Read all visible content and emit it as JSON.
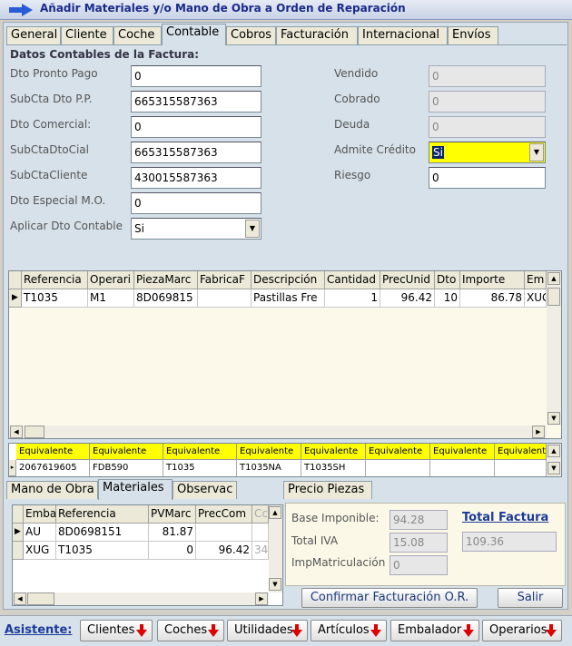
{
  "window": {
    "title": "Añadir Materiales y/o Mano de Obra a Orden de Reparación"
  },
  "tabs": [
    "General",
    "Cliente",
    "Coche",
    "Contable",
    "Cobros",
    "Facturación",
    "Internacional",
    "Envíos"
  ],
  "active_tab": "Contable",
  "section_title": "Datos Contables de la Factura:",
  "left_fields": [
    {
      "label": "Dto Pronto Pago",
      "value": "0"
    },
    {
      "label": "SubCta Dto P.P.",
      "value": "665315587363"
    },
    {
      "label": "Dto Comercial:",
      "value": "0"
    },
    {
      "label": "SubCtaDtoCial",
      "value": "665315587363"
    },
    {
      "label": "SubCtaCliente",
      "value": "430015587363"
    },
    {
      "label": "Dto Especial M.O.",
      "value": "0"
    },
    {
      "label": "Aplicar Dto Contable",
      "value": "Si"
    }
  ],
  "right_fields": [
    {
      "label": "Vendido",
      "value": "0"
    },
    {
      "label": "Cobrado",
      "value": "0"
    },
    {
      "label": "Deuda",
      "value": "0"
    },
    {
      "label": "Admite Crédito",
      "value": "Si"
    },
    {
      "label": "Riesgo",
      "value": "0"
    }
  ],
  "colors": {
    "highlight": "#ffff00",
    "panel": "#d6e1e9",
    "title_text": "#1a2a8a"
  },
  "main_grid": {
    "columns": [
      "Referencia",
      "Operari",
      "PiezaMarc",
      "FabricaF",
      "Descripción",
      "Cantidad",
      "PrecUnid",
      "Dto",
      "Importe",
      "Em"
    ],
    "rows": [
      [
        "T1035",
        "M1",
        "8D069815",
        "",
        "Pastillas Fre",
        "1",
        "96.42",
        "10",
        "86.78",
        "XUG"
      ]
    ]
  },
  "equiv_grid": {
    "headers": [
      "Equivalente",
      "Equivalente",
      "Equivalente",
      "Equivalente",
      "Equivalente",
      "Equivalente",
      "Equivalente",
      "Equivalent"
    ],
    "values": [
      "2067619605",
      "FDB590",
      "T1035",
      "T1035NA",
      "T1035SH",
      "",
      "",
      ""
    ]
  },
  "bottom_tabs": [
    "Mano de Obra",
    "Materiales",
    "Observac"
  ],
  "bottom_active_tab": "Materiales",
  "precio_tab": "Precio Piezas",
  "mat_grid": {
    "columns": [
      "Emba",
      "Referencia",
      "PVMarc",
      "PrecCom",
      "Cc"
    ],
    "rows": [
      [
        "AU",
        "8D0698151",
        "81.87",
        "",
        ""
      ],
      [
        "XUG",
        "T1035",
        "0",
        "96.42",
        "34"
      ]
    ]
  },
  "totals": {
    "base_label": "Base Imponible:",
    "base_value": "94.28",
    "iva_label": "Total IVA",
    "iva_value": "15.08",
    "imp_label": "ImpMatriculación",
    "imp_value": "0",
    "total_label": "Total Factura",
    "total_value": "109.36"
  },
  "buttons": {
    "confirm": "Confirmar Facturación O.R.",
    "exit": "Salir"
  },
  "toolbar": {
    "label": "Asistente:",
    "items": [
      "Clientes",
      "Coches",
      "Utilidades",
      "Artículos",
      "Embalador",
      "Operarios"
    ]
  }
}
